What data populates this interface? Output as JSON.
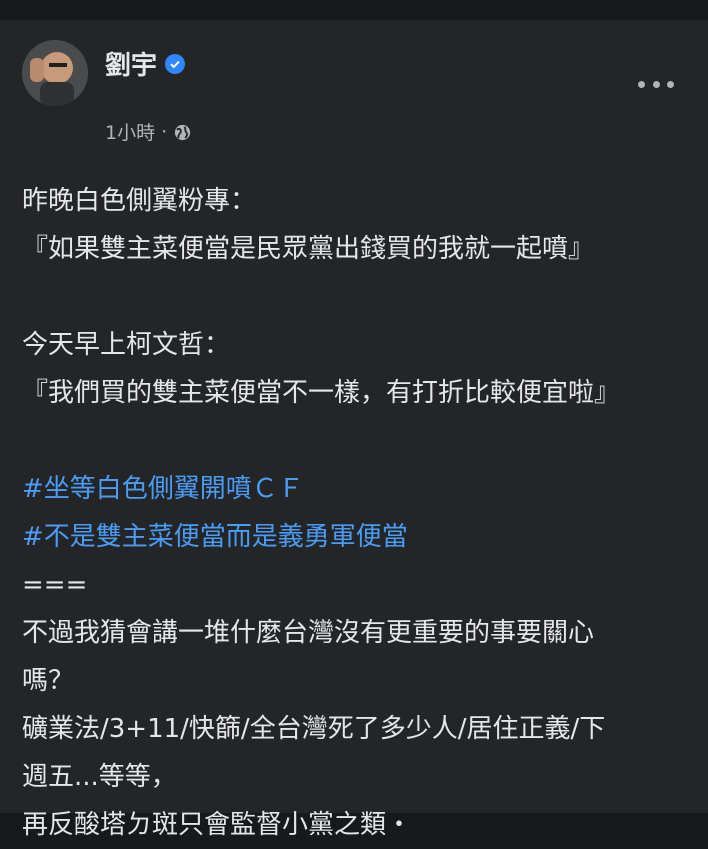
{
  "post": {
    "author": "劉宇",
    "time": "1小時",
    "separator": "·",
    "lines": [
      {
        "text": "昨晚白色側翼粉專："
      },
      {
        "text": "『如果雙主菜便當是民眾黨出錢買的我就一起噴』"
      },
      {
        "text": ""
      },
      {
        "text": "今天早上柯文哲："
      },
      {
        "text": "『我們買的雙主菜便當不一樣，有打折比較便宜啦』"
      },
      {
        "text": ""
      },
      {
        "text": "#坐等白色側翼開噴ＣＦ"
      },
      {
        "text": "#不是雙主菜便當而是義勇軍便當"
      },
      {
        "text": "==="
      },
      {
        "text": "不過我猜會講一堆什麼台灣沒有更重要的事要關心"
      },
      {
        "text": "嗎？"
      },
      {
        "text": "礦業法/3+11/快篩/全台灣死了多少人/居住正義/下"
      },
      {
        "text": "週五...等等，"
      },
      {
        "text": "再反酸塔ㄉ斑只會監督小黨之類・"
      }
    ]
  },
  "icons": {
    "verified": "verified-badge-icon",
    "privacy": "globe-icon",
    "more": "more-options-icon"
  },
  "colors": {
    "background": "#18191a",
    "card": "#242526",
    "text": "#e4e6eb",
    "secondary": "#b0b3b8",
    "hashtag": "#4a9cf5",
    "verified": "#2d88ff"
  }
}
